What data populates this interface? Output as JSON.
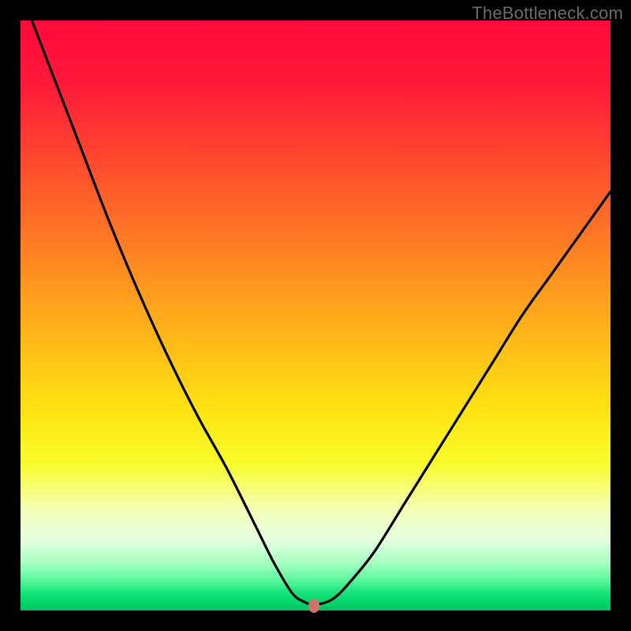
{
  "watermark": "TheBottleneck.com",
  "gradient_colors": {
    "top": "#ff0a3a",
    "mid_upper": "#ff7d24",
    "mid": "#ffe312",
    "mid_lower": "#f4ffb9",
    "bottom": "#00c060"
  },
  "marker": {
    "x_frac": 0.497,
    "y_frac": 0.992,
    "color": "#c8776a"
  },
  "chart_data": {
    "type": "line",
    "title": "",
    "xlabel": "",
    "ylabel": "",
    "xlim": [
      0,
      1
    ],
    "ylim": [
      0,
      1
    ],
    "note": "x is horizontal fraction across the gradient square (0=left,1=right); y is the curve height as fraction of the square (0=bottom,1=top).",
    "series": [
      {
        "name": "bottleneck-curve",
        "x": [
          0.0,
          0.05,
          0.1,
          0.15,
          0.2,
          0.25,
          0.3,
          0.35,
          0.4,
          0.43,
          0.46,
          0.48,
          0.5,
          0.53,
          0.56,
          0.6,
          0.65,
          0.7,
          0.75,
          0.8,
          0.85,
          0.9,
          0.95,
          1.0
        ],
        "y": [
          1.05,
          0.92,
          0.79,
          0.66,
          0.54,
          0.43,
          0.33,
          0.24,
          0.14,
          0.08,
          0.03,
          0.015,
          0.01,
          0.02,
          0.05,
          0.1,
          0.18,
          0.26,
          0.34,
          0.42,
          0.5,
          0.57,
          0.64,
          0.71
        ]
      }
    ],
    "marker_point": {
      "x": 0.497,
      "y": 0.008
    }
  }
}
